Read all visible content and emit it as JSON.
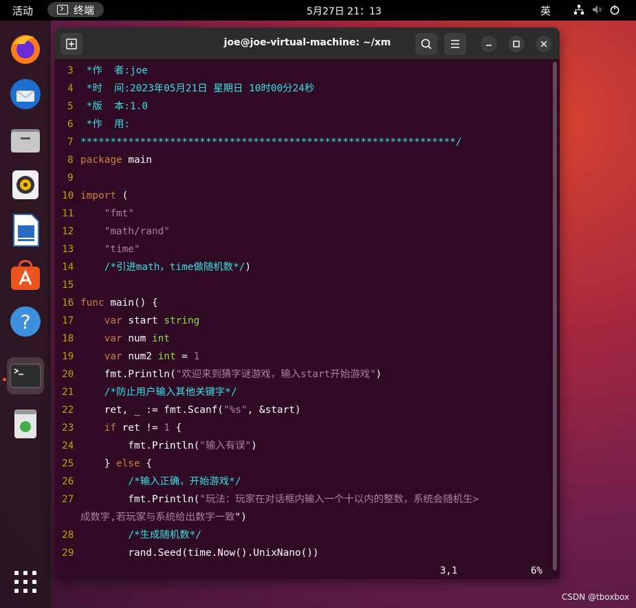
{
  "topbar": {
    "activities": "活动",
    "app_name": "终端",
    "clock": "5月27日  21：13",
    "ime": "英"
  },
  "dock": {
    "items": [
      {
        "name": "firefox-icon"
      },
      {
        "name": "thunderbird-icon"
      },
      {
        "name": "files-icon"
      },
      {
        "name": "rhythmbox-icon"
      },
      {
        "name": "libreoffice-writer-icon"
      },
      {
        "name": "app-center-icon"
      },
      {
        "name": "help-icon"
      },
      {
        "name": "terminal-icon"
      },
      {
        "name": "trash-icon"
      },
      {
        "name": "show-apps-icon"
      }
    ]
  },
  "window": {
    "title": "joe@joe-virtual-machine: ~/xm"
  },
  "editor": {
    "lines": [
      {
        "n": "3",
        "t": " *作  者:joe"
      },
      {
        "n": "4",
        "t": " *时  间:2023年05月21日 星期日 10时00分24秒"
      },
      {
        "n": "5",
        "t": " *版  本:1.0"
      },
      {
        "n": "6",
        "t": " *作  用:"
      },
      {
        "n": "7",
        "t": "***************************************************************/"
      },
      {
        "n": "8",
        "t": "package main"
      },
      {
        "n": "9",
        "t": ""
      },
      {
        "n": "10",
        "t": "import ("
      },
      {
        "n": "11",
        "t": "    \"fmt\""
      },
      {
        "n": "12",
        "t": "    \"math/rand\""
      },
      {
        "n": "13",
        "t": "    \"time\""
      },
      {
        "n": "14",
        "t": "    /*引进math，time做随机数*/)"
      },
      {
        "n": "15",
        "t": ""
      },
      {
        "n": "16",
        "t": "func main() {"
      },
      {
        "n": "17",
        "t": "    var start string"
      },
      {
        "n": "18",
        "t": "    var num int"
      },
      {
        "n": "19",
        "t": "    var num2 int = 1"
      },
      {
        "n": "20",
        "t": "    fmt.Println(\"欢迎来到猜字谜游戏，输入start开始游戏\")"
      },
      {
        "n": "21",
        "t": "    /*防止用户输入其他关键字*/"
      },
      {
        "n": "22",
        "t": "    ret, _ := fmt.Scanf(\"%s\", &start)"
      },
      {
        "n": "23",
        "t": "    if ret != 1 {"
      },
      {
        "n": "24",
        "t": "        fmt.Println(\"输入有误\")"
      },
      {
        "n": "25",
        "t": "    } else {"
      },
      {
        "n": "26",
        "t": "        /*输入正确，开始游戏*/"
      },
      {
        "n": "27",
        "t": "        fmt.Println(\"玩法：玩家在对话框内输入一个十以内的整数，系统会随机生>"
      },
      {
        "n": "",
        "t": "成数字,若玩家与系统给出数字一致\")"
      },
      {
        "n": "28",
        "t": "        /*生成随机数*/"
      },
      {
        "n": "29",
        "t": "        rand.Seed(time.Now().UnixNano())"
      }
    ],
    "cursor_pos": "3,1",
    "scroll_pct": "6%"
  },
  "watermark": "CSDN @tboxbox"
}
